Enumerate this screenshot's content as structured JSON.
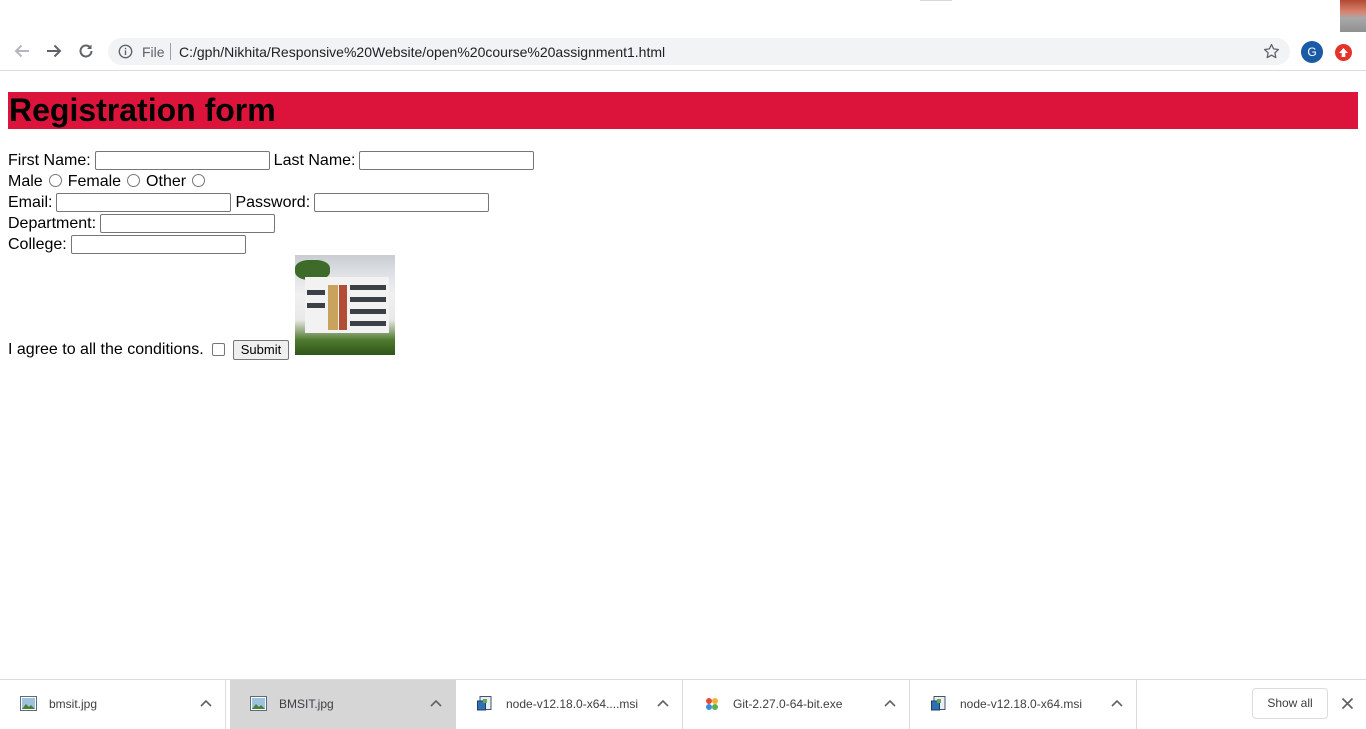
{
  "browser": {
    "address": {
      "scheme_label": "File",
      "url": "C:/gph/Nikhita/Responsive%20Website/open%20course%20assignment1.html"
    },
    "profile_initial": "G",
    "colors": {
      "profile": "#1a5aa6",
      "extension": "#e5332a"
    },
    "icons": [
      "back-arrow-icon",
      "forward-arrow-icon",
      "reload-icon",
      "info-icon",
      "star-icon",
      "profile-avatar",
      "extension-icon"
    ]
  },
  "page": {
    "header_color": "#dc143c",
    "title": "Registration form",
    "form": {
      "first_name_label": "First Name:",
      "last_name_label": "Last Name:",
      "gender_male_label": "Male",
      "gender_female_label": "Female",
      "gender_other_label": "Other",
      "email_label": "Email:",
      "password_label": "Password:",
      "department_label": "Department:",
      "college_label": "College:",
      "agree_label": "I agree to all the conditions.",
      "submit_label": "Submit"
    }
  },
  "downloads": {
    "items": [
      {
        "name": "bmsit.jpg",
        "icon": "image-file-icon"
      },
      {
        "name": "BMSIT.jpg",
        "icon": "image-file-icon"
      },
      {
        "name": "node-v12.18.0-x64....msi",
        "icon": "installer-file-icon"
      },
      {
        "name": "Git-2.27.0-64-bit.exe",
        "icon": "git-installer-icon"
      },
      {
        "name": "node-v12.18.0-x64.msi",
        "icon": "installer-file-icon"
      }
    ],
    "show_all_label": "Show all"
  }
}
